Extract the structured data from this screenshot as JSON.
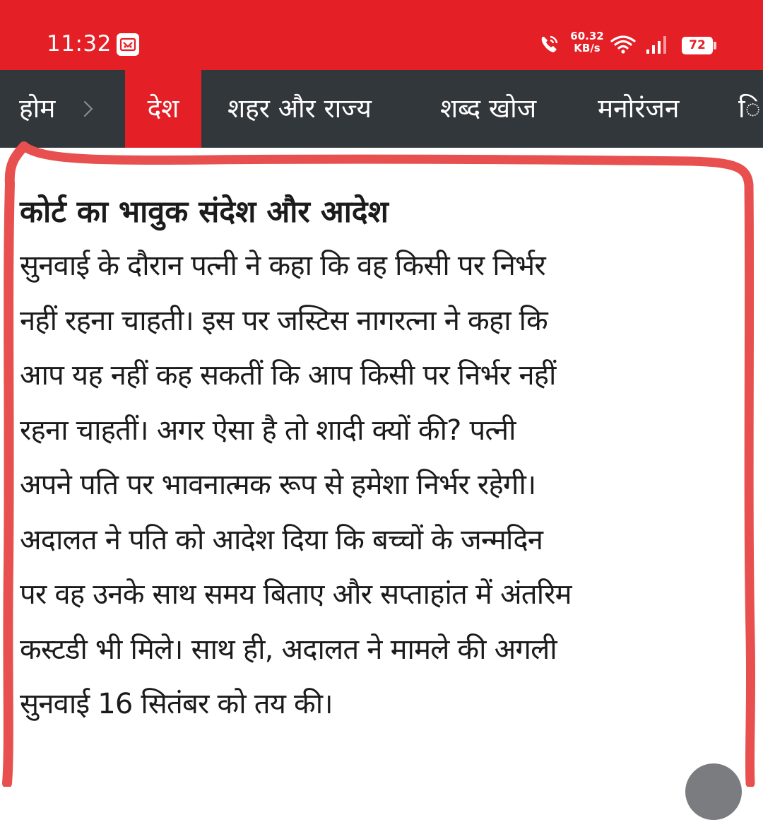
{
  "status_bar": {
    "time": "11:32",
    "network_speed_value": "60.32",
    "network_speed_unit": "KB/s",
    "battery": "72",
    "icons": [
      "app-notification-icon",
      "call-icon",
      "wifi-icon",
      "signal-icon",
      "battery-icon"
    ]
  },
  "nav": {
    "items": [
      {
        "label": "होम"
      },
      {
        "label": "देश"
      },
      {
        "label": "शहर और राज्य"
      },
      {
        "label": "शब्द खोज"
      },
      {
        "label": "मनोरंजन"
      },
      {
        "label": "ि"
      }
    ],
    "active_index": 1
  },
  "article": {
    "heading": "कोर्ट का भावुक संदेश और आदेश",
    "lines": [
      "सुनवाई के दौरान पत्नी ने कहा कि वह किसी पर निर्भर",
      "नहीं रहना चाहती। इस पर जस्टिस नागरत्ना ने कहा कि",
      "आप यह नहीं कह सकतीं कि आप किसी पर निर्भर नहीं",
      "रहना चाहतीं। अगर ऐसा है तो शादी क्यों की? पत्नी",
      "अपने पति पर भावनात्मक रूप से हमेशा निर्भर रहेगी।",
      "अदालत ने पति को आदेश दिया कि बच्चों के जन्मदिन",
      "पर वह उनके साथ समय बिताए और सप्ताहांत में अंतरिम",
      "कस्टडी भी मिले। साथ ही, अदालत ने मामले की अगली",
      "सुनवाई 16 सितंबर को तय की।"
    ]
  },
  "colors": {
    "brand_red": "#e41f26",
    "nav_bg": "#32373c",
    "annotation_red": "#e8504f"
  }
}
